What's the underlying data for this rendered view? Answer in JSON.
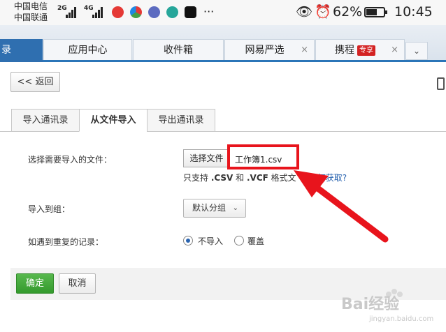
{
  "status_bar": {
    "carrier1": "中国电信",
    "carrier2": "中国联通",
    "net1": "2G",
    "net2": "4G",
    "battery_percent": "62%",
    "battery_level": 0.62,
    "time": "10:45",
    "more": "···"
  },
  "nav": {
    "active_label": "录",
    "tabs": [
      {
        "label": "应用中心"
      },
      {
        "label": "收件箱"
      },
      {
        "label": "网易严选",
        "close": "×"
      },
      {
        "label": "携程",
        "badge": "专享",
        "close": "×"
      }
    ],
    "more": "⌄"
  },
  "back_button": "<< 返回",
  "subtabs": [
    "导入通讯录",
    "从文件导入",
    "导出通讯录"
  ],
  "form": {
    "file_label": "选择需要导入的文件：",
    "choose_button": "选择文件",
    "file_name": "工作簿1.csv",
    "hint_prefix": "只支持 ",
    "hint_csv": ".CSV",
    "hint_and": " 和 ",
    "hint_vcf": ".VCF",
    "hint_suffix": " 格式文",
    "hint_link": "如何获取?",
    "group_label": "导入到组：",
    "group_value": "默认分组",
    "dup_label": "如遇到重复的记录：",
    "dup_options": [
      "不导入",
      "覆盖"
    ]
  },
  "footer": {
    "ok": "确定",
    "cancel": "取消"
  },
  "watermark": {
    "text": "Bai经验",
    "url": "jingyan.baidu.com"
  },
  "colors": {
    "accent_blue": "#2f6fb0",
    "ok_green": "#3aa533",
    "annotation_red": "#e8141c",
    "link_blue": "#2a64b0"
  }
}
